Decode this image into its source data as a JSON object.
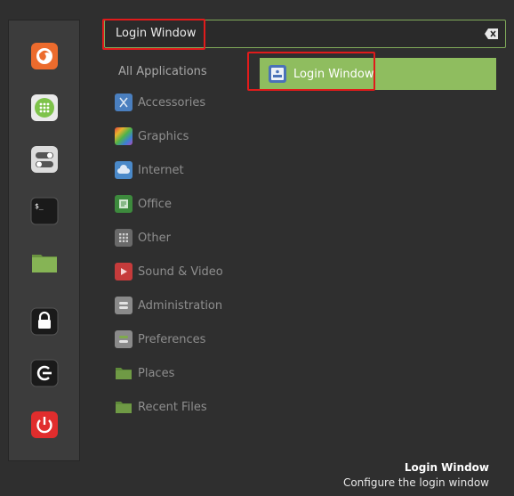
{
  "search": {
    "value": "Login Window"
  },
  "sidebar": {
    "favorites": [
      {
        "name": "firefox-icon",
        "bg": "#ec6b2d"
      },
      {
        "name": "software-manager-icon",
        "bg": "#7ec34a"
      },
      {
        "name": "settings-toggle-icon",
        "bg": "#dcdcdc"
      },
      {
        "name": "terminal-icon",
        "bg": "#1a1a1a"
      },
      {
        "name": "files-folder-icon",
        "bg": "#7fab4c"
      },
      {
        "name": "lock-screen-icon",
        "bg": "#1a1a1a"
      },
      {
        "name": "logout-icon",
        "bg": "#1a1a1a"
      },
      {
        "name": "power-icon",
        "bg": "#e02d2d"
      }
    ]
  },
  "categories": {
    "all_label": "All Applications",
    "items": [
      {
        "label": "Accessories",
        "icon": "scissors-icon",
        "color": "#4a7fbf"
      },
      {
        "label": "Graphics",
        "icon": "graphics-icon",
        "color": "#c94ca8"
      },
      {
        "label": "Internet",
        "icon": "cloud-icon",
        "color": "#4a89c9"
      },
      {
        "label": "Office",
        "icon": "office-icon",
        "color": "#3d8a3d"
      },
      {
        "label": "Other",
        "icon": "grid-icon",
        "color": "#6a6a6a"
      },
      {
        "label": "Sound & Video",
        "icon": "play-icon",
        "color": "#c63b3b"
      },
      {
        "label": "Administration",
        "icon": "admin-icon",
        "color": "#8a8a8a"
      },
      {
        "label": "Preferences",
        "icon": "preferences-icon",
        "color": "#8a8a8a"
      },
      {
        "label": "Places",
        "icon": "folder-icon",
        "color": "#6f9a45"
      },
      {
        "label": "Recent Files",
        "icon": "recent-folder-icon",
        "color": "#6f9a45"
      }
    ]
  },
  "result": {
    "label": "Login Window",
    "icon": "login-window-icon"
  },
  "footer": {
    "name": "Login Window",
    "description": "Configure the login window"
  }
}
